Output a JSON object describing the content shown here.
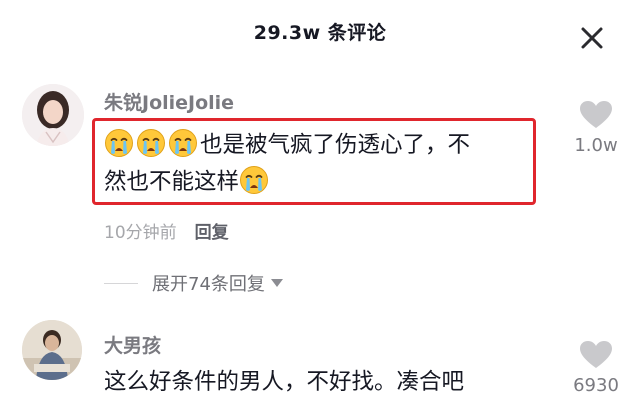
{
  "header": {
    "title": "29.3w 条评论",
    "close_icon": "close-icon"
  },
  "comments": [
    {
      "username": "朱锐JolieJolie",
      "emoji_icon": "crying-face-icon",
      "text_line1": "也是被气疯了伤透心了，不",
      "text_line2": "然也不能这样",
      "time": "10分钟前",
      "reply_label": "回复",
      "expand_label": "展开74条回复",
      "likes": "1.0w",
      "highlight_color": "#e0262d"
    },
    {
      "username": "大男孩",
      "text_line1": "这么好条件的男人，不好找。凑合吧",
      "likes": "6930"
    }
  ],
  "colors": {
    "text_primary": "#161823",
    "text_secondary": "#7a7a80",
    "highlight_border": "#e0262d",
    "like_icon": "#c9c9cc"
  }
}
